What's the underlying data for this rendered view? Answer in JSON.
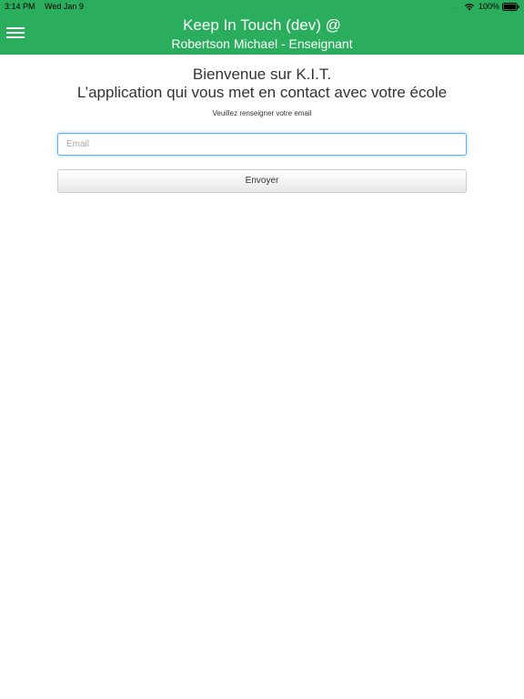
{
  "status_bar": {
    "time": "3:14 PM",
    "date": "Wed Jan 9",
    "signal": "....",
    "battery_percent": "100%",
    "battery_level": 1.0,
    "icons": [
      "wifi-icon",
      "battery-icon"
    ]
  },
  "header": {
    "menu_icon": "hamburger-icon",
    "title": "Keep In Touch (dev) @",
    "subtitle": "Robertson Michael - Enseignant",
    "background_color": "#2bad5e"
  },
  "main": {
    "welcome_title": "Bienvenue sur K.I.T.",
    "welcome_subtitle": "L’application qui vous met en contact avec votre école",
    "instruction": "Veuillez renseigner votre email",
    "email_field": {
      "placeholder": "Email",
      "value": ""
    },
    "send_button_label": "Envoyer"
  }
}
